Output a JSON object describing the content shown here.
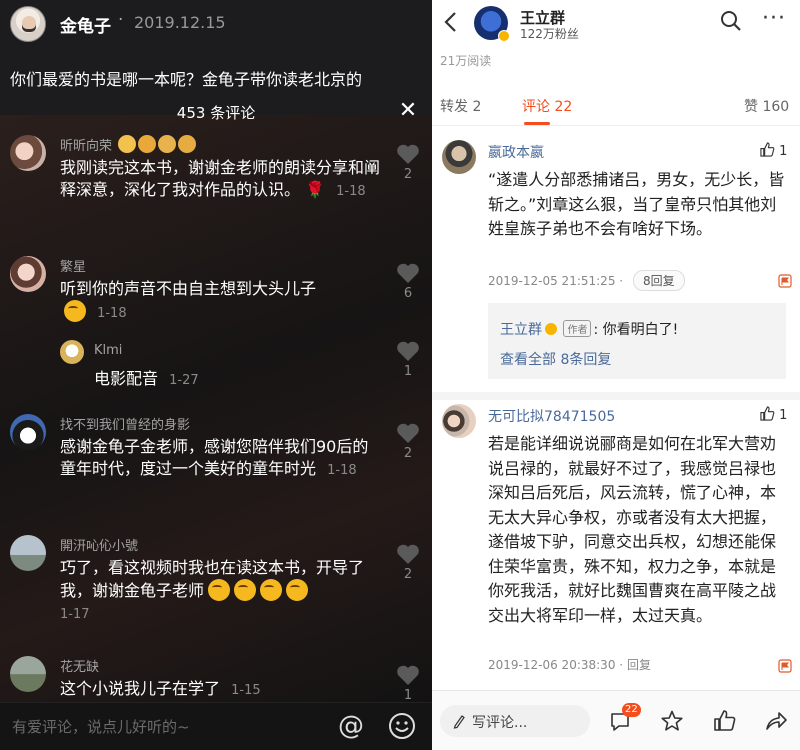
{
  "left": {
    "author": "金龟子",
    "separator": "·",
    "date": "2019.12.15",
    "caption": "你们最爱的书是哪一本呢？金龟子带你读老北京的",
    "comment_count": "453 条评论",
    "comments": [
      {
        "name": "昕昕向荣",
        "text": "我刚读完这本书，谢谢金老师的朗读分享和阐释深意，深化了我对作品的认识。",
        "time": "1-18",
        "likes": "2"
      },
      {
        "name": "繁星",
        "text": "听到你的声音不由自主想到大头儿子",
        "time": "1-18",
        "likes": "6"
      },
      {
        "name": "Klmi",
        "text": "电影配音",
        "time": "1-27",
        "likes": "1"
      },
      {
        "name": "找不到我们曾经的身影",
        "text": "感谢金龟子金老师，感谢您陪伴我们90后的童年时代，度过一个美好的童年时光",
        "time": "1-18",
        "likes": "2"
      },
      {
        "name": "開汧吣伈小號",
        "text": "巧了，看这视频时我也在读这本书，开导了我，谢谢金龟子老师",
        "time": "1-17",
        "likes": "2"
      },
      {
        "name": "花无缺",
        "text": "这个小说我儿子在学了",
        "time": "1-15",
        "likes": "1"
      }
    ],
    "input_placeholder": "有爱评论，说点儿好听的~",
    "at_symbol": "@"
  },
  "right": {
    "user_name": "王立群",
    "fans": "122万粉丝",
    "reads": "21万阅读",
    "more": "···",
    "tabs": {
      "repost": "转发 2",
      "comments": "评论 22",
      "likes": "赞 160"
    },
    "comment1": {
      "name": "嬴政本嬴",
      "likes": "1",
      "text": "“遂遣人分部悉捕诸吕，男女，无少长，皆斩之。”刘章这么狠，当了皇帝只怕其他刘姓皇族子弟也不会有啥好下场。",
      "time": "2019-12-05 21:51:25",
      "sep": "·",
      "replies": "8回复",
      "reply_author": "王立群",
      "reply_tag": "作者",
      "reply_text": ": 你看明白了!",
      "view_all": "查看全部 8条回复"
    },
    "comment2": {
      "name": "无可比拟78471505",
      "likes": "1",
      "text": "若是能详细说说郦商是如何在北军大营劝说吕禄的，就最好不过了，我感觉吕禄也深知吕后死后，风云流转，慌了心神，本无太大异心争权，亦或者没有太大把握，遂借坡下驴，同意交出兵权，幻想还能保住荣华富贵，殊不知，权力之争，本就是你死我活，就好比魏国曹爽在高平陵之战交出大将军印一样，太过天真。",
      "time": "2019-12-06 20:38:30",
      "sep": "·",
      "reply": "回复"
    },
    "write_placeholder": "写评论...",
    "comment_badge": "22"
  },
  "colors": {
    "accent_orange": "#f44d1e",
    "link_blue": "#4a6a9a",
    "dark_bg": "#1c1c1e"
  }
}
